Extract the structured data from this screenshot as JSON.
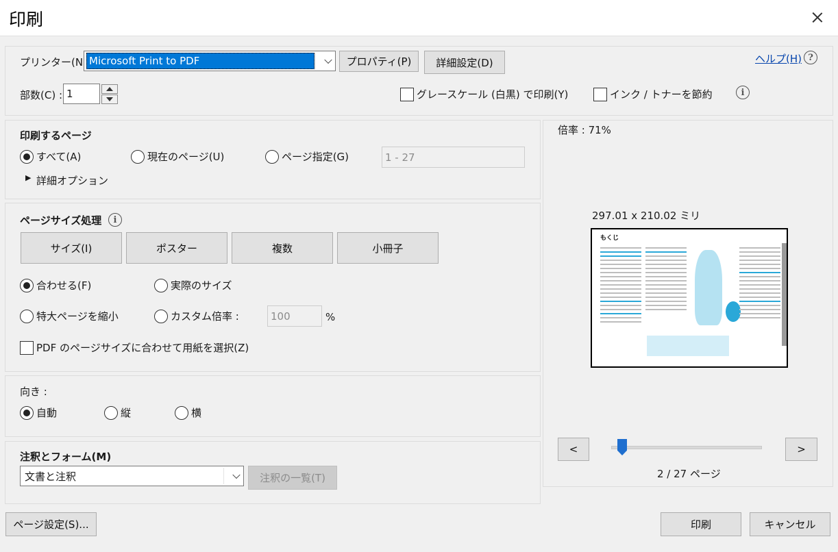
{
  "window": {
    "title": "印刷"
  },
  "printer": {
    "label": "プリンター(N) :",
    "selected": "Microsoft Print to PDF",
    "properties_button": "プロパティ(P)",
    "advanced_button": "詳細設定(D)",
    "help_link": "ヘルプ(H)",
    "copies_label": "部数(C) :",
    "copies_value": "1",
    "grayscale_label": "グレースケール (白黒) で印刷(Y)",
    "save_ink_label": "インク / トナーを節約"
  },
  "pages": {
    "heading": "印刷するページ",
    "all_label": "すべて(A)",
    "current_label": "現在のページ(U)",
    "range_label": "ページ指定(G)",
    "range_value": "1 - 27",
    "more_options_label": "詳細オプション",
    "selected": "all"
  },
  "sizing": {
    "heading": "ページサイズ処理",
    "buttons": [
      "サイズ(I)",
      "ポスター",
      "複数",
      "小冊子"
    ],
    "fit_label": "合わせる(F)",
    "actual_label": "実際のサイズ",
    "shrink_label": "特大ページを縮小",
    "custom_label": "カスタム倍率 :",
    "custom_value": "100",
    "percent": "%",
    "pdf_paper_label": "PDF のページサイズに合わせて用紙を選択(Z)",
    "selected": "fit"
  },
  "orientation": {
    "heading": "向き :",
    "auto_label": "自動",
    "portrait_label": "縦",
    "landscape_label": "横",
    "selected": "auto"
  },
  "annotations": {
    "heading": "注釈とフォーム(M)",
    "selected": "文書と注釈",
    "summary_button": "注釈の一覧(T)"
  },
  "preview": {
    "zoom": "倍率 : 71%",
    "dimensions": "297.01 x 210.02 ミリ",
    "page_info": "2 / 27 ページ",
    "prev_button": "<",
    "next_button": ">",
    "current_page": 2,
    "total_pages": 27,
    "thumbnail_heading": "もくじ"
  },
  "footer": {
    "page_setup_button": "ページ設定(S)...",
    "print_button": "印刷",
    "cancel_button": "キャンセル"
  },
  "colors": {
    "selection": "#0078d7",
    "accent_cyan": "#2aa8d8",
    "slider": "#1f6fcf"
  }
}
